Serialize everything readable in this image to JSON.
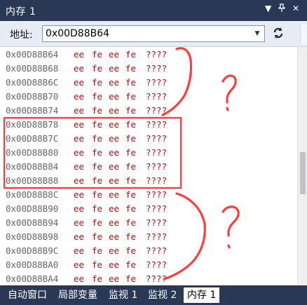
{
  "window": {
    "title": "内存 1",
    "icons": [
      "dropdown-icon",
      "pin-icon",
      "close-icon"
    ]
  },
  "toolbar": {
    "address_label": "地址:",
    "address_value": "0x00D88B64",
    "refresh_icon": "refresh-icon"
  },
  "memory": {
    "rows": [
      {
        "address": "0x00D88B64",
        "bytes": [
          "ee",
          "fe",
          "ee",
          "fe"
        ],
        "chars": "????"
      },
      {
        "address": "0x00D88B68",
        "bytes": [
          "ee",
          "fe",
          "ee",
          "fe"
        ],
        "chars": "????"
      },
      {
        "address": "0x00D88B6C",
        "bytes": [
          "ee",
          "fe",
          "ee",
          "fe"
        ],
        "chars": "????"
      },
      {
        "address": "0x00D88B70",
        "bytes": [
          "ee",
          "fe",
          "ee",
          "fe"
        ],
        "chars": "????"
      },
      {
        "address": "0x00D88B74",
        "bytes": [
          "ee",
          "fe",
          "ee",
          "fe"
        ],
        "chars": "????"
      },
      {
        "address": "0x00D88B78",
        "bytes": [
          "ee",
          "fe",
          "ee",
          "fe"
        ],
        "chars": "????"
      },
      {
        "address": "0x00D88B7C",
        "bytes": [
          "ee",
          "fe",
          "ee",
          "fe"
        ],
        "chars": "????"
      },
      {
        "address": "0x00D88B80",
        "bytes": [
          "ee",
          "fe",
          "ee",
          "fe"
        ],
        "chars": "????"
      },
      {
        "address": "0x00D88B84",
        "bytes": [
          "ee",
          "fe",
          "ee",
          "fe"
        ],
        "chars": "????"
      },
      {
        "address": "0x00D88B88",
        "bytes": [
          "ee",
          "fe",
          "ee",
          "fe"
        ],
        "chars": "????"
      },
      {
        "address": "0x00D88B8C",
        "bytes": [
          "ee",
          "fe",
          "ee",
          "fe"
        ],
        "chars": "????"
      },
      {
        "address": "0x00D88B90",
        "bytes": [
          "ee",
          "fe",
          "ee",
          "fe"
        ],
        "chars": "????"
      },
      {
        "address": "0x00D88B94",
        "bytes": [
          "ee",
          "fe",
          "ee",
          "fe"
        ],
        "chars": "????"
      },
      {
        "address": "0x00D88B98",
        "bytes": [
          "ee",
          "fe",
          "ee",
          "fe"
        ],
        "chars": "????"
      },
      {
        "address": "0x00D88B9C",
        "bytes": [
          "ee",
          "fe",
          "ee",
          "fe"
        ],
        "chars": "????"
      },
      {
        "address": "0x00D88BA0",
        "bytes": [
          "ee",
          "fe",
          "ee",
          "fe"
        ],
        "chars": "????"
      },
      {
        "address": "0x00D88BA4",
        "bytes": [
          "ee",
          "fe",
          "ee",
          "fe"
        ],
        "chars": "????"
      }
    ]
  },
  "tabs": [
    {
      "label": "自动窗口",
      "active": false
    },
    {
      "label": "局部变量",
      "active": false
    },
    {
      "label": "监视 1",
      "active": false
    },
    {
      "label": "监视 2",
      "active": false
    },
    {
      "label": "内存 1",
      "active": true
    }
  ],
  "annotations": {
    "color": "#ff3b3b",
    "marks": [
      "?",
      "?"
    ]
  },
  "colors": {
    "title_bg": "#293955",
    "toolbar_bg": "#e8ecf4",
    "byte_text": "#a31515",
    "address_text": "#666666"
  }
}
